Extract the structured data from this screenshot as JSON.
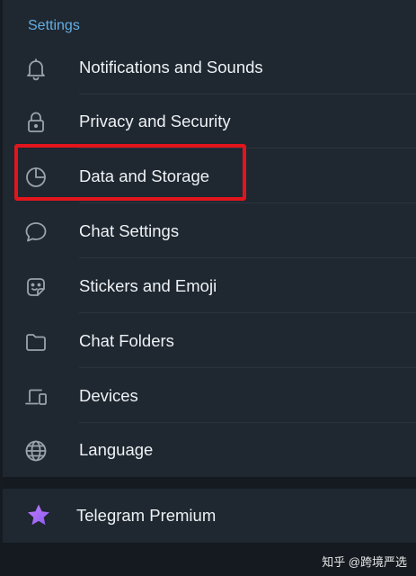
{
  "section_title": "Settings",
  "items": [
    {
      "label": "Notifications and Sounds",
      "icon": "bell-icon"
    },
    {
      "label": "Privacy and Security",
      "icon": "lock-icon"
    },
    {
      "label": "Data and Storage",
      "icon": "pie-chart-icon"
    },
    {
      "label": "Chat Settings",
      "icon": "chat-bubble-icon"
    },
    {
      "label": "Stickers and Emoji",
      "icon": "sticker-icon"
    },
    {
      "label": "Chat Folders",
      "icon": "folder-icon"
    },
    {
      "label": "Devices",
      "icon": "devices-icon"
    },
    {
      "label": "Language",
      "icon": "globe-icon"
    }
  ],
  "premium": {
    "label": "Telegram Premium",
    "icon": "star-icon"
  },
  "watermark": "知乎 @跨境严选",
  "colors": {
    "background": "#141a20",
    "card": "#1f2730",
    "accent": "#63aee4",
    "text": "#eef2f5",
    "icon": "#9aa3ab",
    "highlight": "#e3151c",
    "premium_star": "#a86cf2"
  }
}
